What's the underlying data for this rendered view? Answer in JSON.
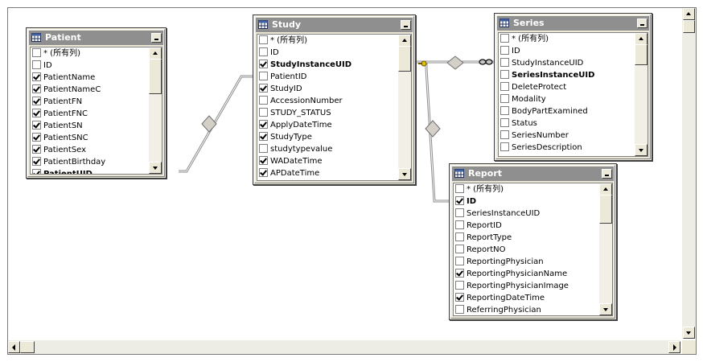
{
  "tables": {
    "patient": {
      "name": "Patient",
      "rows": [
        {
          "label": "* (所有列)",
          "checked": false,
          "bold": false
        },
        {
          "label": "ID",
          "checked": false,
          "bold": false
        },
        {
          "label": "PatientName",
          "checked": true,
          "bold": false
        },
        {
          "label": "PatientNameC",
          "checked": true,
          "bold": false
        },
        {
          "label": "PatientFN",
          "checked": true,
          "bold": false
        },
        {
          "label": "PatientFNC",
          "checked": true,
          "bold": false
        },
        {
          "label": "PatientSN",
          "checked": true,
          "bold": false
        },
        {
          "label": "PatientSNC",
          "checked": true,
          "bold": false
        },
        {
          "label": "PatientSex",
          "checked": true,
          "bold": false
        },
        {
          "label": "PatientBirthday",
          "checked": true,
          "bold": false
        },
        {
          "label": "PatientUID",
          "checked": true,
          "bold": true
        }
      ]
    },
    "study": {
      "name": "Study",
      "rows": [
        {
          "label": "* (所有列)",
          "checked": false,
          "bold": false
        },
        {
          "label": "ID",
          "checked": false,
          "bold": false
        },
        {
          "label": "StudyInstanceUID",
          "checked": true,
          "bold": true
        },
        {
          "label": "PatientID",
          "checked": false,
          "bold": false
        },
        {
          "label": "StudyID",
          "checked": true,
          "bold": false
        },
        {
          "label": "AccessionNumber",
          "checked": false,
          "bold": false
        },
        {
          "label": "STUDY_STATUS",
          "checked": false,
          "bold": false
        },
        {
          "label": "ApplyDateTime",
          "checked": true,
          "bold": false
        },
        {
          "label": "StudyType",
          "checked": true,
          "bold": false
        },
        {
          "label": "studytypevalue",
          "checked": false,
          "bold": false
        },
        {
          "label": "WADateTime",
          "checked": true,
          "bold": false
        },
        {
          "label": "APDateTime",
          "checked": true,
          "bold": false
        }
      ]
    },
    "series": {
      "name": "Series",
      "rows": [
        {
          "label": "* (所有列)",
          "checked": false,
          "bold": false
        },
        {
          "label": "ID",
          "checked": false,
          "bold": false
        },
        {
          "label": "StudyInstanceUID",
          "checked": false,
          "bold": false
        },
        {
          "label": "SeriesInstanceUID",
          "checked": false,
          "bold": true
        },
        {
          "label": "DeleteProtect",
          "checked": false,
          "bold": false
        },
        {
          "label": "Modality",
          "checked": false,
          "bold": false
        },
        {
          "label": "BodyPartExamined",
          "checked": false,
          "bold": false
        },
        {
          "label": "Status",
          "checked": false,
          "bold": false
        },
        {
          "label": "SeriesNumber",
          "checked": false,
          "bold": false
        },
        {
          "label": "SeriesDescription",
          "checked": false,
          "bold": false
        }
      ]
    },
    "report": {
      "name": "Report",
      "rows": [
        {
          "label": "* (所有列)",
          "checked": false,
          "bold": false
        },
        {
          "label": "ID",
          "checked": true,
          "bold": true
        },
        {
          "label": "SeriesInstanceUID",
          "checked": false,
          "bold": false
        },
        {
          "label": "ReportID",
          "checked": false,
          "bold": false
        },
        {
          "label": "ReportType",
          "checked": false,
          "bold": false
        },
        {
          "label": "ReportNO",
          "checked": false,
          "bold": false
        },
        {
          "label": "ReportingPhysician",
          "checked": false,
          "bold": false
        },
        {
          "label": "ReportingPhysicianName",
          "checked": true,
          "bold": false
        },
        {
          "label": "ReportingPhysicianImage",
          "checked": false,
          "bold": false
        },
        {
          "label": "ReportingDateTime",
          "checked": true,
          "bold": false
        },
        {
          "label": "ReferringPhysician",
          "checked": false,
          "bold": false
        }
      ]
    }
  },
  "colors": {
    "title_bar": "#8f8f8f",
    "window_face": "#ece9d8",
    "relationship_line": "#8c8c8c"
  },
  "icons": {
    "table": "table-grid-icon",
    "minimize": "minimize-icon",
    "relationship": "diamond-join-icon",
    "key": "key-icon",
    "infinity": "infinity-icon"
  }
}
